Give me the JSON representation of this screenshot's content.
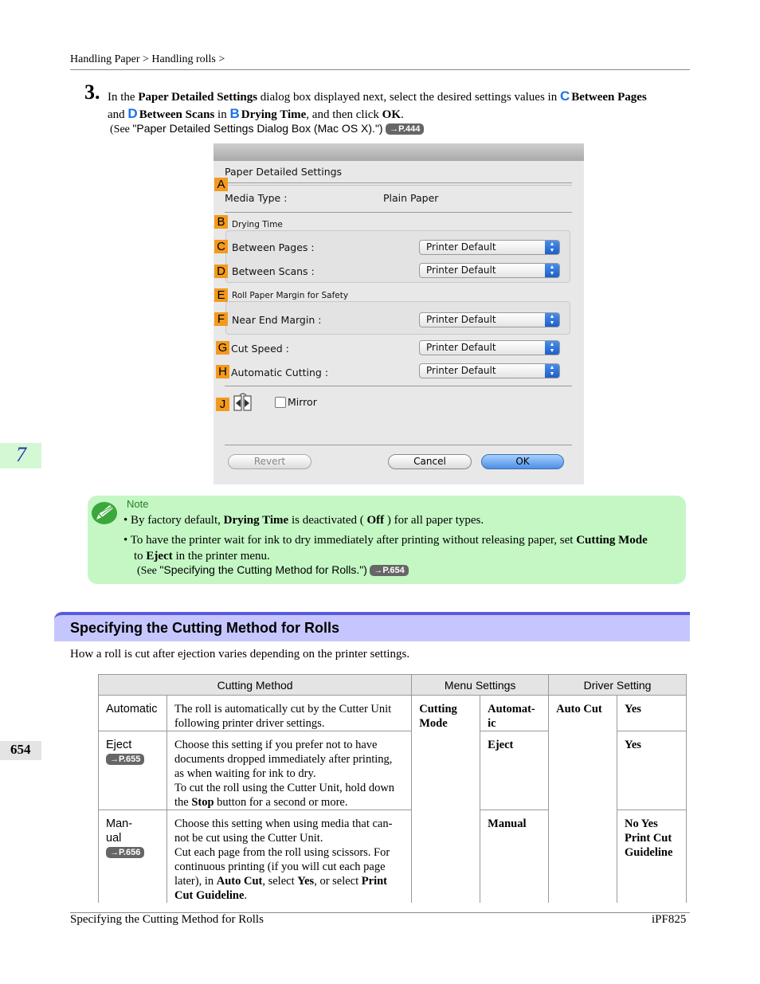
{
  "header": {
    "breadcrumb": "Handling Paper > Handling rolls >"
  },
  "step": {
    "number": "3.",
    "line1_a": "In the",
    "line1_b": "Paper Detailed Settings",
    "line1_c": "dialog box displayed next, select the desired settings values in",
    "letter_c": "C",
    "between_pages": "Between Pages",
    "line2_a": "and",
    "letter_d": "D",
    "between_scans": "Between Scans",
    "line2_in": "in",
    "letter_b": "B",
    "drying_time": "Drying Time",
    "line2_c": ", and then click",
    "ok": "OK",
    "line2_end": ".",
    "see_prefix": "(See",
    "see_quote": "\"Paper Detailed Settings Dialog Box (Mac OS X).\")",
    "see_ref": "→P.444"
  },
  "dialog": {
    "title": "Paper Detailed Settings",
    "media_type_label": "Media Type :",
    "media_type_value": "Plain Paper",
    "drying_time_group": "Drying Time",
    "between_pages_label": "Between Pages :",
    "between_scans_label": "Between Scans :",
    "roll_margin_group": "Roll Paper Margin for Safety",
    "near_end_margin_label": "Near End Margin :",
    "cut_speed_label": "Cut Speed :",
    "automatic_cutting_label": "Automatic Cutting :",
    "mirror_label": "Mirror",
    "popup_value": "Printer Default",
    "revert_button": "Revert",
    "cancel_button": "Cancel",
    "ok_button": "OK",
    "tags": {
      "a": "A",
      "b": "B",
      "c": "C",
      "d": "D",
      "e": "E",
      "f": "F",
      "g": "G",
      "h": "H",
      "j": "J"
    }
  },
  "chapter": {
    "number": "7"
  },
  "note": {
    "label": "Note",
    "b1_a": "By factory default,",
    "b1_b": "Drying Time",
    "b1_c": "is deactivated (",
    "b1_d": "Off",
    "b1_e": ") for all paper types.",
    "b2_a": "To have the printer wait for ink to dry immediately after printing without releasing paper, set",
    "b2_b": "Cutting Mode",
    "b2_c": "to",
    "b2_d": "Eject",
    "b2_e": "in the printer menu.",
    "see_prefix": "(See",
    "see_quote": "\"Specifying the Cutting Method for Rolls.\")",
    "see_ref": "→P.654"
  },
  "section": {
    "title": "Specifying the Cutting Method for Rolls",
    "intro": "How a roll is cut after ejection varies depending on the printer settings."
  },
  "table": {
    "headers": [
      "Cutting Method",
      "Menu Settings",
      "Driver Setting"
    ],
    "rows": [
      {
        "method": "Automatic",
        "description": "The roll is automatically cut by the Cutter Unit following printer driver settings.",
        "menu_item": "Cutting Mode",
        "menu_value": "Automat-ic",
        "driver_item": "Auto Cut",
        "driver_value": "Yes"
      },
      {
        "method": "Eject",
        "ref": "→P.655",
        "description_1": "Choose this setting if you prefer not to have documents dropped immediately after printing, as when waiting for ink to dry.",
        "description_2a": "To cut the roll using the Cutter Unit, hold down the",
        "description_2b": "Stop",
        "description_2c": "button for a second or more.",
        "menu_value": "Eject",
        "driver_value": "Yes"
      },
      {
        "method": "Man-ual",
        "ref": "→P.656",
        "description_1": "Choose this setting when using media that can-not be cut using the Cutter Unit.",
        "description_2a": "Cut each page from the roll using scissors. For continuous printing (if you will cut each page later), in",
        "description_2b": "Auto Cut",
        "description_2c": ", select",
        "description_2d": "Yes",
        "description_2e": ", or select",
        "description_2f": "Print Cut Guideline",
        "description_2g": ".",
        "menu_value": "Manual",
        "driver_value": "No Yes Print Cut Guideline"
      }
    ]
  },
  "page_number": "654",
  "footer": {
    "left": "Specifying the Cutting Method for Rolls",
    "right": "iPF825"
  }
}
